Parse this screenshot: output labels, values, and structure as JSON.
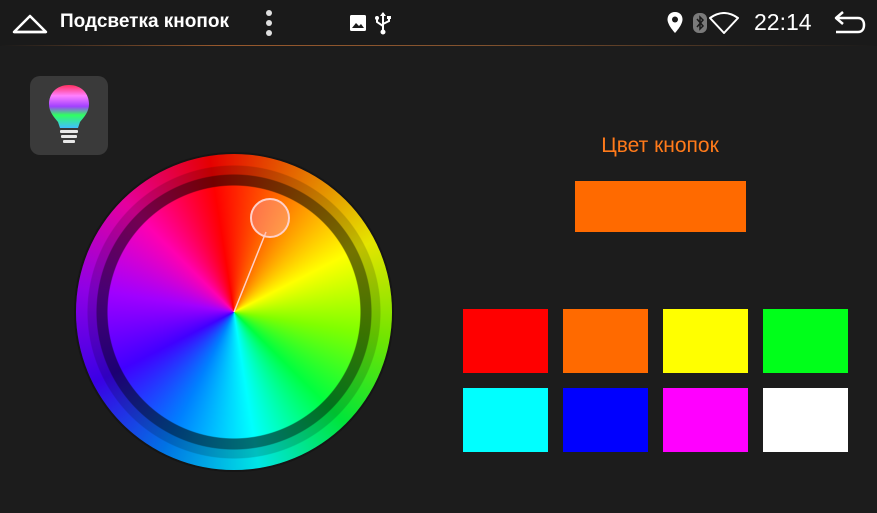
{
  "status_bar": {
    "title": "Подсветка кнопок",
    "time": "22:14",
    "icons": [
      "home-icon",
      "menu-icon",
      "image-icon",
      "usb-icon",
      "location-icon",
      "bluetooth-icon",
      "wifi-icon",
      "back-icon"
    ]
  },
  "panel": {
    "label": "Цвет кнопок",
    "current_color": "#ff6a00"
  },
  "presets": [
    {
      "name": "preset-red",
      "color": "#ff0000"
    },
    {
      "name": "preset-orange",
      "color": "#ff6a00"
    },
    {
      "name": "preset-yellow",
      "color": "#ffff00"
    },
    {
      "name": "preset-green",
      "color": "#00ff1a"
    },
    {
      "name": "preset-cyan",
      "color": "#00ffff"
    },
    {
      "name": "preset-blue",
      "color": "#0000ff"
    },
    {
      "name": "preset-magenta",
      "color": "#ff00ff"
    },
    {
      "name": "preset-white",
      "color": "#ffffff"
    }
  ],
  "colors": {
    "background": "#1c1c1c",
    "accent": "#ff7a1a"
  }
}
